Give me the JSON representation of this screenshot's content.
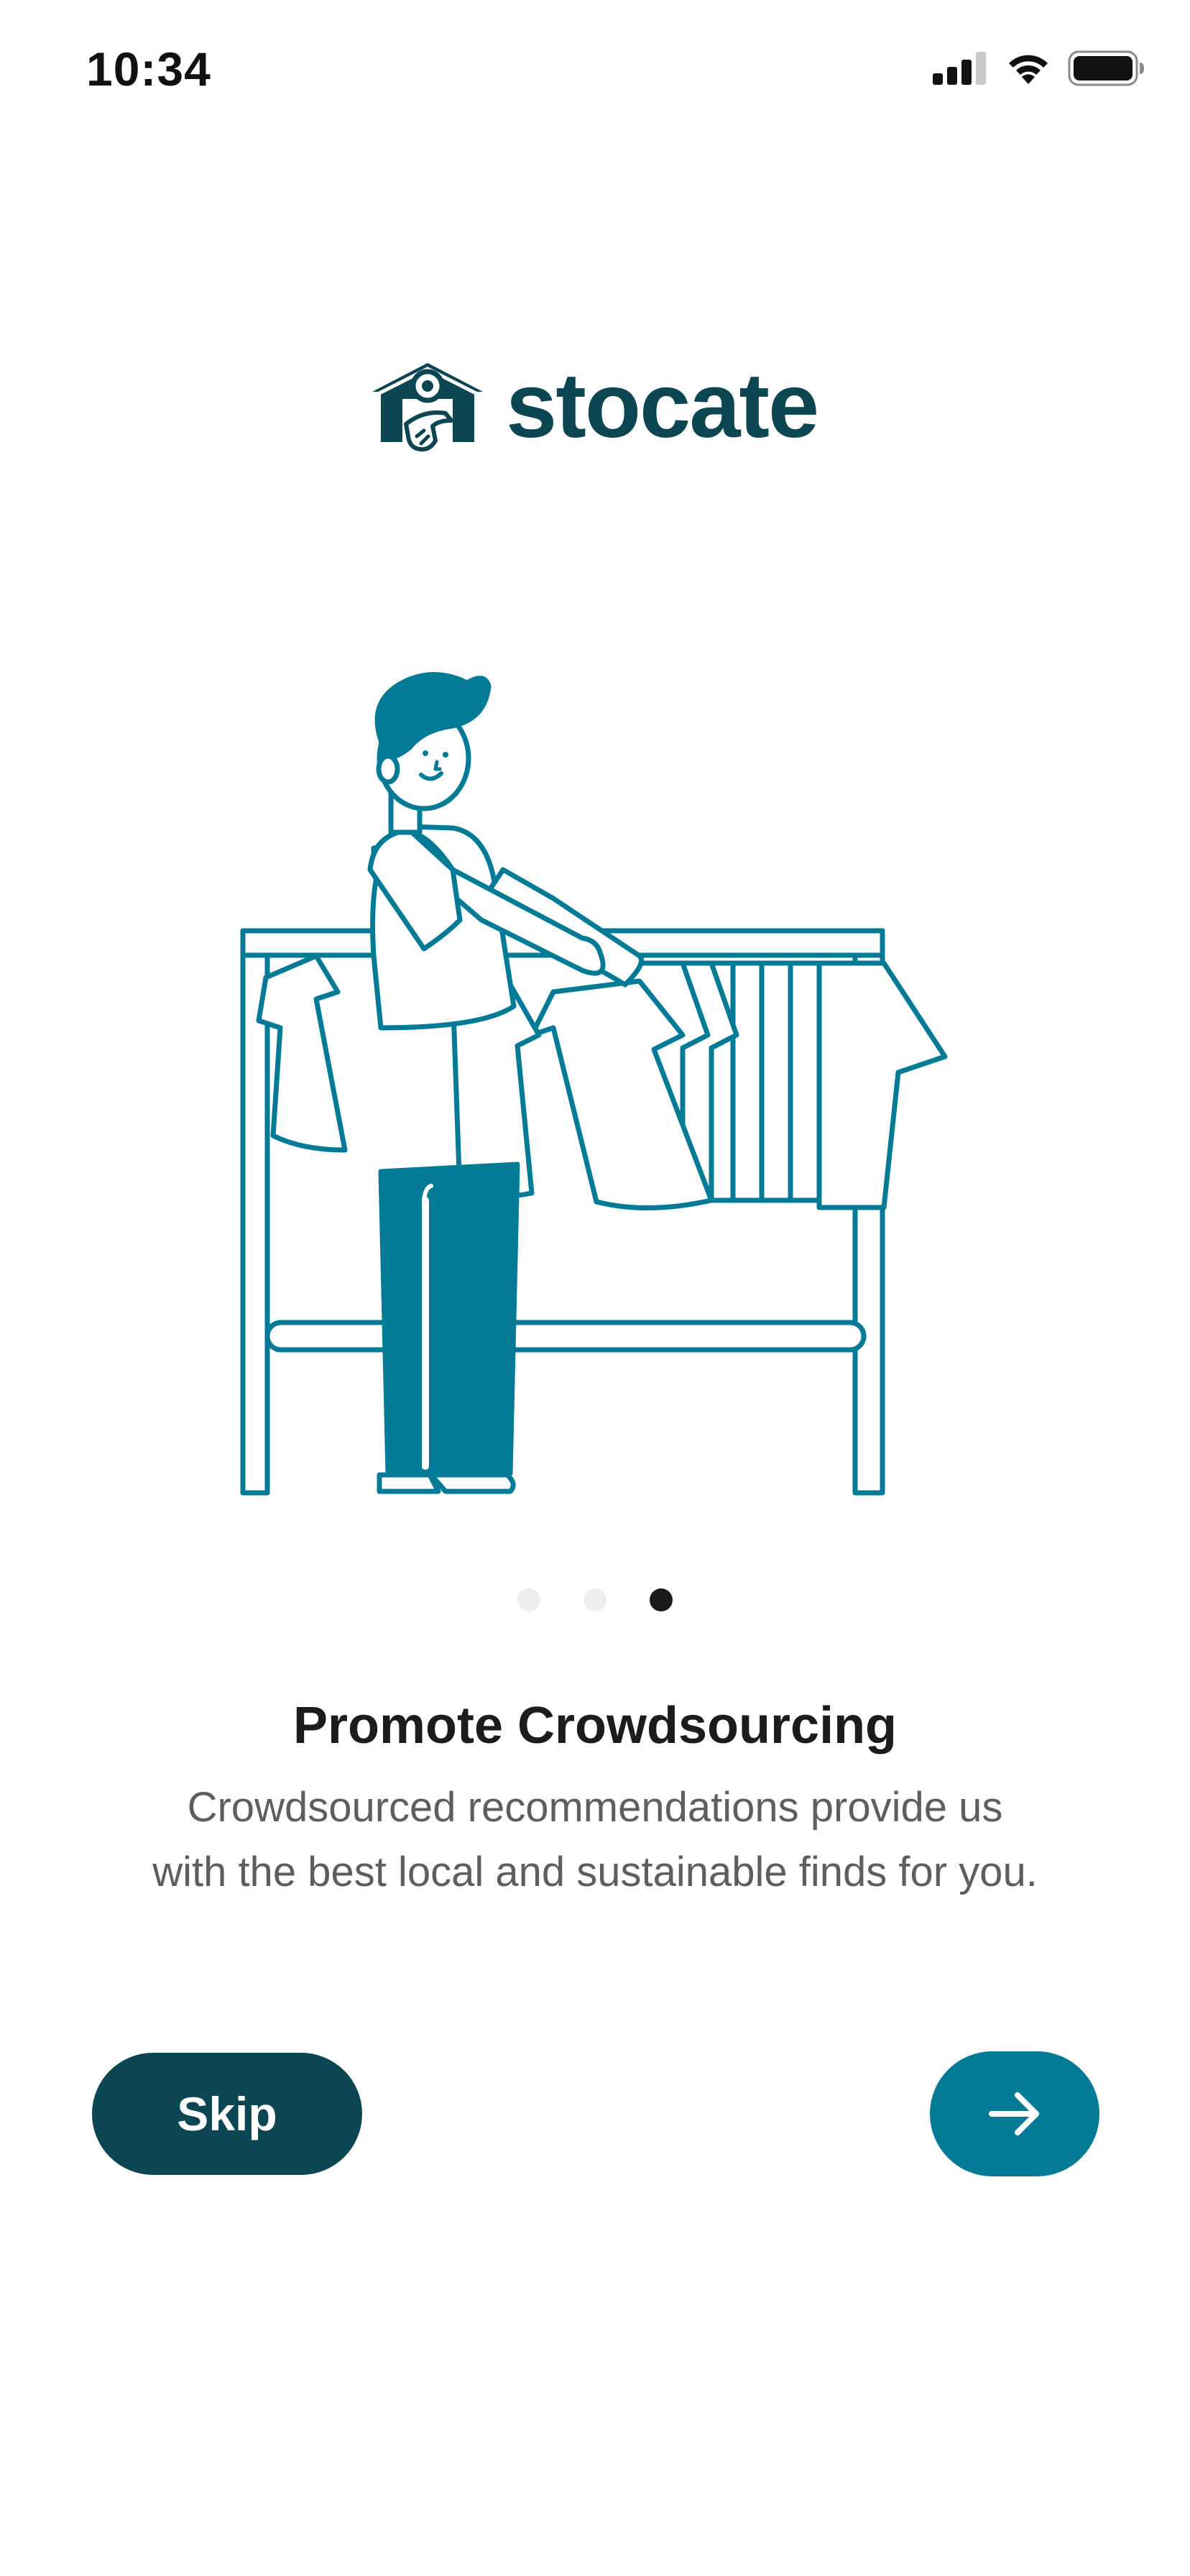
{
  "status_bar": {
    "time": "10:34",
    "icons": [
      "cellular-signal-icon",
      "wifi-icon",
      "battery-icon"
    ]
  },
  "logo": {
    "wordmark": "stocate",
    "icon": "stocate-logo-icon"
  },
  "illustration": {
    "icon": "person-browsing-clothing-rack-illustration"
  },
  "pager": {
    "total": 3,
    "current": 3
  },
  "onboarding": {
    "title": "Promote Crowdsourcing",
    "description_line1": "Crowdsourced recommendations provide us",
    "description_line2": "with the best local and sustainable finds for you."
  },
  "actions": {
    "skip_label": "Skip",
    "next_icon": "arrow-right-icon"
  },
  "colors": {
    "brand_dark": "#0b4652",
    "brand_teal": "#047b96",
    "text_primary": "#1c1c1c",
    "text_secondary": "#5e5e5e",
    "dot_inactive": "#eeeeee",
    "dot_active": "#1b1b1b"
  }
}
